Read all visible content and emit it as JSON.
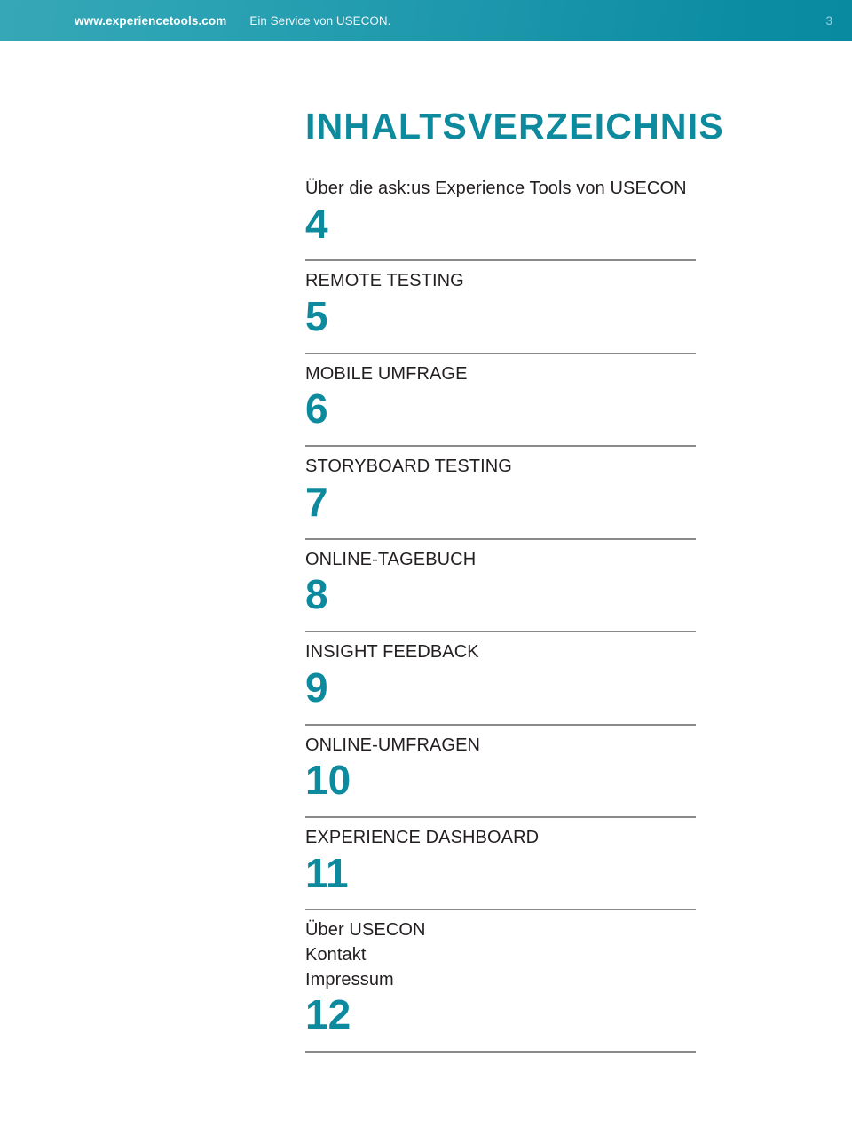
{
  "header": {
    "site": "www.experiencetools.com",
    "tagline": "Ein Service von USECON.",
    "page_number": "3",
    "background_gradient_from": "#37a7b6",
    "background_gradient_to": "#0a8aa1",
    "text_color": "#ffffff",
    "page_number_color": "#8fd6e2"
  },
  "accent_color": "#0e8a9e",
  "rule_color": "#8a8a8a",
  "title": "INHALTSVERZEICHNIS",
  "toc": {
    "entries": [
      {
        "labels": [
          "Über die ask:us Experience Tools von USECON"
        ],
        "page": "4"
      },
      {
        "labels": [
          "REMOTE TESTING"
        ],
        "page": "5"
      },
      {
        "labels": [
          "MOBILE UMFRAGE"
        ],
        "page": "6"
      },
      {
        "labels": [
          "STORYBOARD TESTING"
        ],
        "page": "7"
      },
      {
        "labels": [
          "ONLINE-TAGEBUCH"
        ],
        "page": "8"
      },
      {
        "labels": [
          "INSIGHT FEEDBACK"
        ],
        "page": "9"
      },
      {
        "labels": [
          "ONLINE-UMFRAGEN"
        ],
        "page": "10"
      },
      {
        "labels": [
          "EXPERIENCE DASHBOARD"
        ],
        "page": "11"
      },
      {
        "labels": [
          "Über USECON",
          "Kontakt",
          "Impressum"
        ],
        "page": "12"
      }
    ]
  }
}
